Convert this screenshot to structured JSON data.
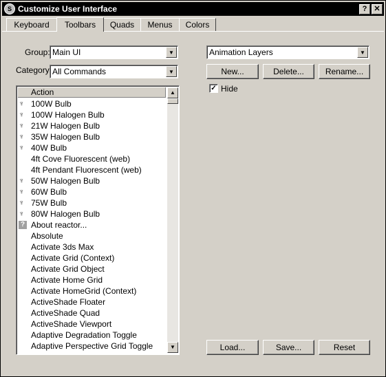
{
  "window": {
    "title": "Customize User Interface",
    "help_label": "?",
    "close_label": "✕"
  },
  "tabs": [
    {
      "label": "Keyboard"
    },
    {
      "label": "Toolbars",
      "active": true
    },
    {
      "label": "Quads"
    },
    {
      "label": "Menus"
    },
    {
      "label": "Colors"
    }
  ],
  "left": {
    "group_label": "Group:",
    "group_value": "Main UI",
    "category_label": "Category:",
    "category_value": "All Commands",
    "list_header": "Action",
    "actions": [
      {
        "label": "100W Bulb",
        "icon": "bulb-icon"
      },
      {
        "label": "100W Halogen Bulb",
        "icon": "bulb-icon"
      },
      {
        "label": "21W Halogen Bulb",
        "icon": "bulb-icon"
      },
      {
        "label": "35W Halogen Bulb",
        "icon": "bulb-icon"
      },
      {
        "label": "40W Bulb",
        "icon": "bulb-icon"
      },
      {
        "label": "4ft Cove Fluorescent (web)",
        "icon": ""
      },
      {
        "label": "4ft Pendant Fluorescent (web)",
        "icon": ""
      },
      {
        "label": "50W Halogen Bulb",
        "icon": "bulb-icon"
      },
      {
        "label": "60W Bulb",
        "icon": "bulb-icon"
      },
      {
        "label": "75W Bulb",
        "icon": "bulb-icon"
      },
      {
        "label": "80W Halogen Bulb",
        "icon": "bulb-icon"
      },
      {
        "label": "About reactor...",
        "icon": "question-icon"
      },
      {
        "label": "Absolute",
        "icon": ""
      },
      {
        "label": "Activate 3ds Max",
        "icon": ""
      },
      {
        "label": "Activate Grid (Context)",
        "icon": ""
      },
      {
        "label": "Activate Grid Object",
        "icon": ""
      },
      {
        "label": "Activate Home Grid",
        "icon": ""
      },
      {
        "label": "Activate HomeGrid (Context)",
        "icon": ""
      },
      {
        "label": "ActiveShade Floater",
        "icon": ""
      },
      {
        "label": "ActiveShade Quad",
        "icon": ""
      },
      {
        "label": "ActiveShade Viewport",
        "icon": ""
      },
      {
        "label": "Adaptive Degradation Toggle",
        "icon": ""
      },
      {
        "label": "Adaptive Perspective Grid Toggle",
        "icon": ""
      }
    ]
  },
  "right": {
    "toolbar_value": "Animation Layers",
    "new_label": "New...",
    "delete_label": "Delete...",
    "rename_label": "Rename...",
    "hide_label": "Hide",
    "hide_checked_mark": "✓"
  },
  "bottom": {
    "load_label": "Load...",
    "save_label": "Save...",
    "reset_label": "Reset"
  }
}
